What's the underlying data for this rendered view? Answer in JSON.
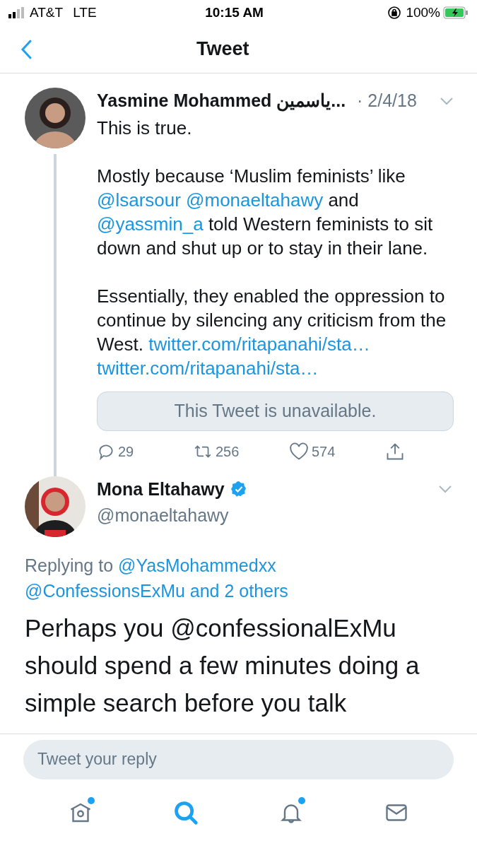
{
  "status_bar": {
    "carrier": "AT&T",
    "network": "LTE",
    "time": "10:15 AM",
    "battery": "100%"
  },
  "header": {
    "title": "Tweet"
  },
  "tweets": [
    {
      "name": "Yasmine Mohammed ياسمين...",
      "verified": false,
      "date": "· 2/4/18",
      "thread_line": true,
      "kind": "timeline",
      "paragraphs": [
        [
          {
            "kind": "text",
            "text": "This is true."
          }
        ],
        [
          {
            "kind": "text",
            "text": "Mostly because ‘Muslim feminists’ like "
          },
          {
            "kind": "link",
            "text": "@lsarsour"
          },
          {
            "kind": "link",
            "text": " @monaeltahawy"
          },
          {
            "kind": "text",
            "text": " and "
          },
          {
            "kind": "link",
            "text": "@yassmin_a"
          },
          {
            "kind": "text",
            "text": " told Western feminists to sit down and shut up or to stay in their lane."
          }
        ],
        [
          {
            "kind": "text",
            "text": "Essentially, they enabled the oppression to continue by silencing any criticism from the West. "
          },
          {
            "kind": "link",
            "text": "twitter.com/ritapanahi/sta…"
          },
          {
            "kind": "link",
            "text": " twitter.com/ritapanahi/sta…"
          }
        ]
      ],
      "quote": "This Tweet is unavailable.",
      "actions": [
        {
          "kind": "reply",
          "count": "29"
        },
        {
          "kind": "retweet",
          "count": "256"
        },
        {
          "kind": "like",
          "count": "574"
        },
        {
          "kind": "share"
        }
      ]
    },
    {
      "name": "Mona Eltahawy",
      "verified": true,
      "handle": "@monaeltahawy",
      "thread_line": false,
      "kind": "focused",
      "replying": [
        {
          "kind": "text",
          "text": "Replying to "
        },
        {
          "kind": "link",
          "text": "@YasMohammedxx"
        },
        {
          "kind": "link",
          "text": " @ConfessionsExMu and 2 others"
        }
      ],
      "paragraphs": [
        [
          {
            "kind": "text",
            "text": "Perhaps you @confessionalExMu should spend a few minutes doing a simple search before you talk"
          }
        ]
      ]
    }
  ],
  "reply_box": {
    "placeholder": "Tweet your reply"
  },
  "tabs": [
    {
      "kind": "home",
      "selected": false,
      "badge": true
    },
    {
      "kind": "search",
      "selected": true,
      "badge": false
    },
    {
      "kind": "notifications",
      "selected": false,
      "badge": true
    },
    {
      "kind": "messages",
      "selected": false,
      "badge": false
    }
  ]
}
